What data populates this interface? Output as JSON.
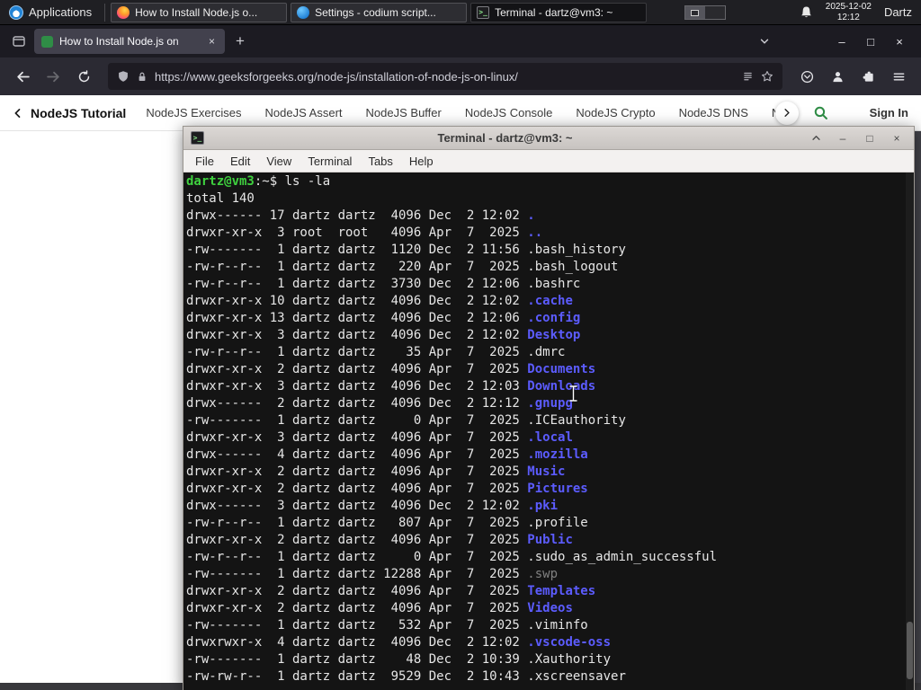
{
  "colors": {
    "gfg_green": "#2f8d46",
    "dir_blue": "#5c5cff",
    "prompt_green": "#3fd13f"
  },
  "taskbar": {
    "applications_label": "Applications",
    "windows": [
      {
        "label": "How to Install Node.js o...",
        "icon": "firefox"
      },
      {
        "label": "Settings - codium script...",
        "icon": "codium-settings"
      },
      {
        "label": "Terminal - dartz@vm3: ~",
        "icon": "terminal"
      }
    ],
    "clock_date": "2025-12-02",
    "clock_time": "12:12",
    "user_label": "Dartz"
  },
  "browser": {
    "tab_title": "How to Install Node.js on",
    "url": "https://www.geeksforgeeks.org/node-js/installation-of-node-js-on-linux/"
  },
  "site_nav": {
    "active_item": "NodeJS Tutorial",
    "items": [
      "NodeJS Exercises",
      "NodeJS Assert",
      "NodeJS Buffer",
      "NodeJS Console",
      "NodeJS Crypto",
      "NodeJS DNS",
      "Node"
    ],
    "sign_in_label": "Sign In"
  },
  "terminal": {
    "title": "Terminal - dartz@vm3: ~",
    "menu_items": [
      "File",
      "Edit",
      "View",
      "Terminal",
      "Tabs",
      "Help"
    ],
    "prompt_user": "dartz@vm3",
    "prompt_suffix": ":~$",
    "command": "ls -la",
    "total_line": "total 140",
    "listing": [
      {
        "pre": "drwx------ 17 dartz dartz  4096 Dec  2 12:02 ",
        "name": ".",
        "cls": "dir"
      },
      {
        "pre": "drwxr-xr-x  3 root  root   4096 Apr  7  2025 ",
        "name": "..",
        "cls": "dir"
      },
      {
        "pre": "-rw-------  1 dartz dartz  1120 Dec  2 11:56 ",
        "name": ".bash_history",
        "cls": "file"
      },
      {
        "pre": "-rw-r--r--  1 dartz dartz   220 Apr  7  2025 ",
        "name": ".bash_logout",
        "cls": "file"
      },
      {
        "pre": "-rw-r--r--  1 dartz dartz  3730 Dec  2 12:06 ",
        "name": ".bashrc",
        "cls": "file"
      },
      {
        "pre": "drwxr-xr-x 10 dartz dartz  4096 Dec  2 12:02 ",
        "name": ".cache",
        "cls": "dir"
      },
      {
        "pre": "drwxr-xr-x 13 dartz dartz  4096 Dec  2 12:06 ",
        "name": ".config",
        "cls": "dir"
      },
      {
        "pre": "drwxr-xr-x  3 dartz dartz  4096 Dec  2 12:02 ",
        "name": "Desktop",
        "cls": "dir"
      },
      {
        "pre": "-rw-r--r--  1 dartz dartz    35 Apr  7  2025 ",
        "name": ".dmrc",
        "cls": "file"
      },
      {
        "pre": "drwxr-xr-x  2 dartz dartz  4096 Apr  7  2025 ",
        "name": "Documents",
        "cls": "dir"
      },
      {
        "pre": "drwxr-xr-x  3 dartz dartz  4096 Dec  2 12:03 ",
        "name": "Downloads",
        "cls": "dir"
      },
      {
        "pre": "drwx------  2 dartz dartz  4096 Dec  2 12:12 ",
        "name": ".gnupg",
        "cls": "dir"
      },
      {
        "pre": "-rw-------  1 dartz dartz     0 Apr  7  2025 ",
        "name": ".ICEauthority",
        "cls": "file"
      },
      {
        "pre": "drwxr-xr-x  3 dartz dartz  4096 Apr  7  2025 ",
        "name": ".local",
        "cls": "dir"
      },
      {
        "pre": "drwx------  4 dartz dartz  4096 Apr  7  2025 ",
        "name": ".mozilla",
        "cls": "dir"
      },
      {
        "pre": "drwxr-xr-x  2 dartz dartz  4096 Apr  7  2025 ",
        "name": "Music",
        "cls": "dir"
      },
      {
        "pre": "drwxr-xr-x  2 dartz dartz  4096 Apr  7  2025 ",
        "name": "Pictures",
        "cls": "dir"
      },
      {
        "pre": "drwx------  3 dartz dartz  4096 Dec  2 12:02 ",
        "name": ".pki",
        "cls": "dir"
      },
      {
        "pre": "-rw-r--r--  1 dartz dartz   807 Apr  7  2025 ",
        "name": ".profile",
        "cls": "file"
      },
      {
        "pre": "drwxr-xr-x  2 dartz dartz  4096 Apr  7  2025 ",
        "name": "Public",
        "cls": "dir"
      },
      {
        "pre": "-rw-r--r--  1 dartz dartz     0 Apr  7  2025 ",
        "name": ".sudo_as_admin_successful",
        "cls": "file"
      },
      {
        "pre": "-rw-------  1 dartz dartz 12288 Apr  7  2025 ",
        "name": ".swp",
        "cls": "dim"
      },
      {
        "pre": "drwxr-xr-x  2 dartz dartz  4096 Apr  7  2025 ",
        "name": "Templates",
        "cls": "dir"
      },
      {
        "pre": "drwxr-xr-x  2 dartz dartz  4096 Apr  7  2025 ",
        "name": "Videos",
        "cls": "dir"
      },
      {
        "pre": "-rw-------  1 dartz dartz   532 Apr  7  2025 ",
        "name": ".viminfo",
        "cls": "file"
      },
      {
        "pre": "drwxrwxr-x  4 dartz dartz  4096 Dec  2 12:02 ",
        "name": ".vscode-oss",
        "cls": "dir"
      },
      {
        "pre": "-rw-------  1 dartz dartz    48 Dec  2 10:39 ",
        "name": ".Xauthority",
        "cls": "file"
      },
      {
        "pre": "-rw-rw-r--  1 dartz dartz  9529 Dec  2 10:43 ",
        "name": ".xscreensaver",
        "cls": "file"
      }
    ]
  }
}
